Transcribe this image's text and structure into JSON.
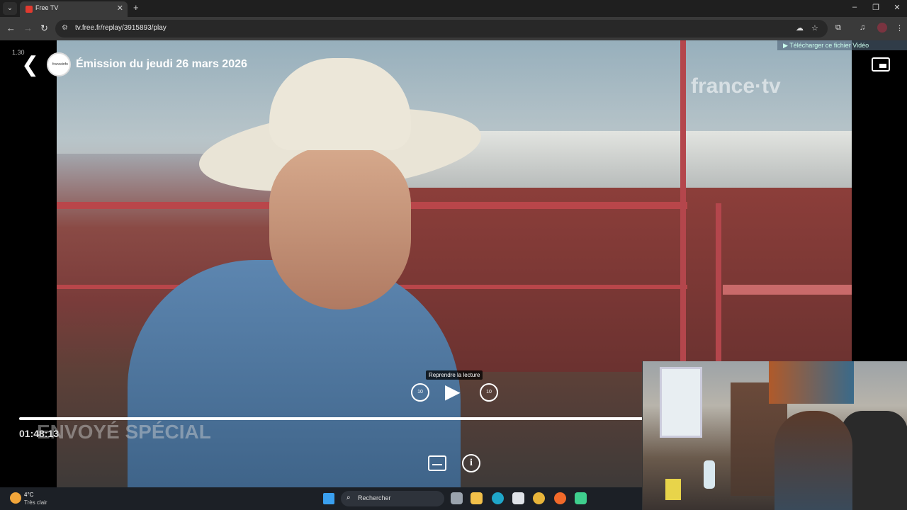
{
  "browser": {
    "tab_title": "Free TV",
    "new_tab": "+",
    "url": "tv.free.fr/replay/3915893/play",
    "nav": {
      "back": "←",
      "forward": "→",
      "reload": "↻"
    },
    "window_controls": {
      "minimize": "–",
      "restore": "❐",
      "close": "✕"
    }
  },
  "player": {
    "counter": "1.30",
    "episode_title": "Émission du jeudi 26 mars 2026",
    "channel_logo_text": "franceinfo",
    "watermark": "france·tv",
    "download_link": "▶ Télécharger ce fichier Vidéo",
    "show_watermark": "ENVOYÉ SPÉCIAL",
    "tooltip": "Reprendre la lecture",
    "rewind_label": "10",
    "forward_label": "10",
    "time": "01:48:13",
    "progress_fraction": 1.0,
    "info_label": "i"
  },
  "taskbar": {
    "temperature": "4°C",
    "condition": "Très clair",
    "search_placeholder": "Rechercher",
    "apps": [
      "task-view",
      "file-explorer",
      "edge",
      "store",
      "chrome",
      "firefox",
      "app"
    ]
  }
}
